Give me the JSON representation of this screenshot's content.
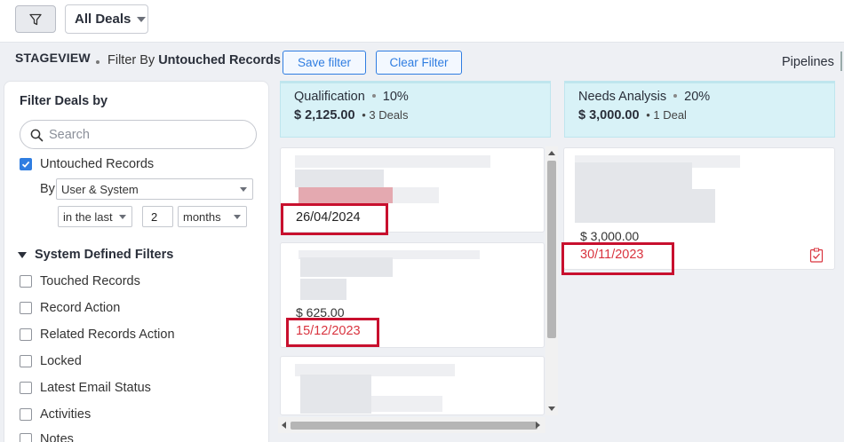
{
  "toolbar": {
    "filter_icon": "funnel-icon",
    "view_select": "All Deals"
  },
  "subheader": {
    "view_label": "STAGEVIEW",
    "filter_by_prefix": "Filter By",
    "filter_by_value": "Untouched Records",
    "save_filter": "Save filter",
    "clear_filter": "Clear Filter",
    "pipelines": "Pipelines"
  },
  "filter_panel": {
    "title": "Filter Deals by",
    "search_placeholder": "Search",
    "untouched": {
      "label": "Untouched Records",
      "checked": true
    },
    "by_label": "By",
    "by_value": "User & System",
    "range_value": "in the last",
    "range_number": "2",
    "range_unit": "months",
    "system_section": "System Defined Filters",
    "system_filters": [
      "Touched Records",
      "Record Action",
      "Related Records Action",
      "Locked",
      "Latest Email Status",
      "Activities",
      "Notes"
    ]
  },
  "stages": [
    {
      "name": "Qualification",
      "probability": "10%",
      "amount": "$ 2,125.00",
      "count": "3 Deals"
    },
    {
      "name": "Needs Analysis",
      "probability": "20%",
      "amount": "$ 3,000.00",
      "count": "1 Deal"
    }
  ],
  "cards": {
    "q1": {
      "date": "26/04/2024"
    },
    "q2": {
      "amount": "$ 625.00",
      "date": "15/12/2023"
    },
    "n1": {
      "amount": "$ 3,000.00",
      "date": "30/11/2023",
      "task_icon": "task-check-icon"
    }
  },
  "colors": {
    "accent": "#2f7de1",
    "overdue": "#d9343f",
    "highlight_box": "#c8102e",
    "stage_bg": "#d8f2f7"
  }
}
